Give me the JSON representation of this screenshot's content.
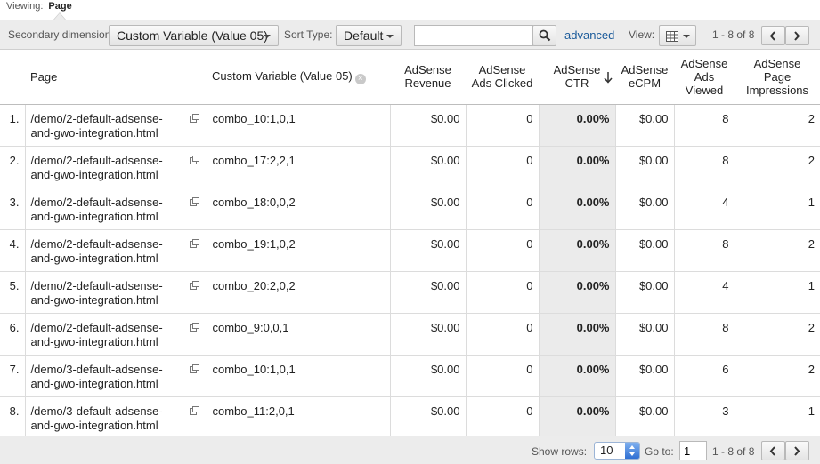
{
  "viewing": {
    "label": "Viewing:",
    "value": "Page"
  },
  "toolbar": {
    "secondary_dimension_label": "Secondary dimension:",
    "secondary_dimension_value": "Custom Variable (Value 05)",
    "sort_type_label": "Sort Type:",
    "sort_type_value": "Default",
    "search_value": "",
    "advanced_label": "advanced",
    "view_label": "View:",
    "range": "1 - 8 of 8"
  },
  "columns": {
    "page": "Page",
    "custom_var": "Custom Variable (Value 05)",
    "revenue": [
      "AdSense",
      "Revenue"
    ],
    "clicked": [
      "AdSense",
      "Ads Clicked"
    ],
    "ctr": [
      "AdSense",
      "CTR"
    ],
    "ecpm": [
      "AdSense",
      "eCPM"
    ],
    "viewed": [
      "AdSense",
      "Ads",
      "Viewed"
    ],
    "impressions": [
      "AdSense",
      "Page",
      "Impressions"
    ]
  },
  "rows": [
    {
      "idx": "1.",
      "page": [
        "/demo/2-default-adsense-",
        "and-gwo-integration.html"
      ],
      "cv": "combo_10:1,0,1",
      "revenue": "$0.00",
      "clicked": "0",
      "ctr": "0.00%",
      "ecpm": "$0.00",
      "viewed": "8",
      "impressions": "2"
    },
    {
      "idx": "2.",
      "page": [
        "/demo/2-default-adsense-",
        "and-gwo-integration.html"
      ],
      "cv": "combo_17:2,2,1",
      "revenue": "$0.00",
      "clicked": "0",
      "ctr": "0.00%",
      "ecpm": "$0.00",
      "viewed": "8",
      "impressions": "2"
    },
    {
      "idx": "3.",
      "page": [
        "/demo/2-default-adsense-",
        "and-gwo-integration.html"
      ],
      "cv": "combo_18:0,0,2",
      "revenue": "$0.00",
      "clicked": "0",
      "ctr": "0.00%",
      "ecpm": "$0.00",
      "viewed": "4",
      "impressions": "1"
    },
    {
      "idx": "4.",
      "page": [
        "/demo/2-default-adsense-",
        "and-gwo-integration.html"
      ],
      "cv": "combo_19:1,0,2",
      "revenue": "$0.00",
      "clicked": "0",
      "ctr": "0.00%",
      "ecpm": "$0.00",
      "viewed": "8",
      "impressions": "2"
    },
    {
      "idx": "5.",
      "page": [
        "/demo/2-default-adsense-",
        "and-gwo-integration.html"
      ],
      "cv": "combo_20:2,0,2",
      "revenue": "$0.00",
      "clicked": "0",
      "ctr": "0.00%",
      "ecpm": "$0.00",
      "viewed": "4",
      "impressions": "1"
    },
    {
      "idx": "6.",
      "page": [
        "/demo/2-default-adsense-",
        "and-gwo-integration.html"
      ],
      "cv": "combo_9:0,0,1",
      "revenue": "$0.00",
      "clicked": "0",
      "ctr": "0.00%",
      "ecpm": "$0.00",
      "viewed": "8",
      "impressions": "2"
    },
    {
      "idx": "7.",
      "page": [
        "/demo/3-default-adsense-",
        "and-gwo-integration.html"
      ],
      "cv": "combo_10:1,0,1",
      "revenue": "$0.00",
      "clicked": "0",
      "ctr": "0.00%",
      "ecpm": "$0.00",
      "viewed": "6",
      "impressions": "2"
    },
    {
      "idx": "8.",
      "page": [
        "/demo/3-default-adsense-",
        "and-gwo-integration.html"
      ],
      "cv": "combo_11:2,0,1",
      "revenue": "$0.00",
      "clicked": "0",
      "ctr": "0.00%",
      "ecpm": "$0.00",
      "viewed": "3",
      "impressions": "1"
    }
  ],
  "footer": {
    "show_rows_label": "Show rows:",
    "show_rows_value": "10",
    "goto_label": "Go to:",
    "goto_value": "1",
    "range": "1 - 8 of 8"
  },
  "icons": {
    "popout": "popout-icon",
    "remove": "remove-dimension-icon",
    "search": "search-icon",
    "grid": "grid-view-icon",
    "prev": "chevron-left-icon",
    "next": "chevron-right-icon",
    "sort": "sort-descending-icon"
  },
  "colors": {
    "link": "#1a5a9a",
    "toolbar_bg": "#ececec",
    "sorted_column_bg": "#ebebeb"
  }
}
